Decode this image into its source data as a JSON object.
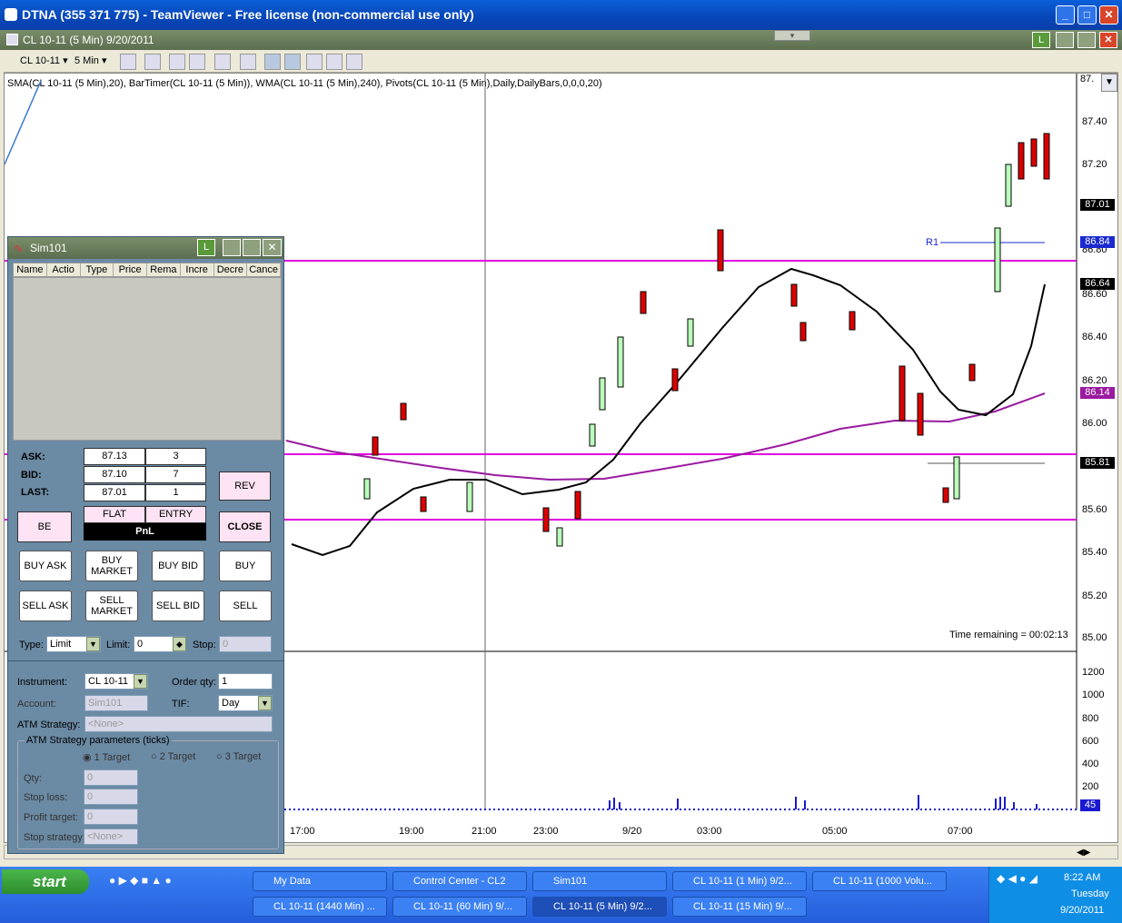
{
  "teamviewer": {
    "title": "DTNA (355 371 775) - TeamViewer - Free license (non-commercial use only)"
  },
  "chart_window": {
    "title": "CL 10-11 (5 Min)  9/20/2011"
  },
  "toolbar": {
    "instrument": "CL 10-11",
    "interval": "5 Min"
  },
  "chart": {
    "indicators": "SMA(CL 10-11 (5 Min),20), BarTimer(CL 10-11 (5 Min)), WMA(CL 10-11 (5 Min),240), Pivots(CL 10-11 (5 Min),Daily,DailyBars,0,0,0,20)",
    "y_labels": [
      "87.40",
      "87.20",
      "86.80",
      "86.60",
      "86.40",
      "86.20",
      "86.00",
      "85.60",
      "85.40",
      "85.20",
      "85.00"
    ],
    "y_top": "87.",
    "price_tags": {
      "last": "87.01",
      "r1": "86.84",
      "c1": "86.64",
      "wma": "86.14",
      "s": "85.81"
    },
    "r1_label": "R1",
    "volume_labels": [
      "1200",
      "1000",
      "800",
      "600",
      "400",
      "200"
    ],
    "volume_tag": "45",
    "time_remaining": "Time remaining = 00:02:13",
    "x_labels": [
      "17:00",
      "19:00",
      "21:00",
      "23:00",
      "9/20",
      "03:00",
      "05:00",
      "07:00"
    ]
  },
  "sim": {
    "title": "Sim101",
    "columns": [
      "Name",
      "Actio",
      "Type",
      "Price",
      "Rema",
      "Incre",
      "Decre",
      "Cance"
    ],
    "ask_label": "ASK:",
    "ask": "87.13",
    "ask_size": "3",
    "bid_label": "BID:",
    "bid": "87.10",
    "bid_size": "7",
    "last_label": "LAST:",
    "last": "87.01",
    "last_size": "1",
    "flat": "FLAT",
    "entry": "ENTRY",
    "pnl": "PnL",
    "rev": "REV",
    "be": "BE",
    "close": "CLOSE",
    "buy_ask": "BUY ASK",
    "buy_market": "BUY MARKET",
    "buy_bid": "BUY BID",
    "buy": "BUY",
    "sell_ask": "SELL ASK",
    "sell_market": "SELL MARKET",
    "sell_bid": "SELL BID",
    "sell": "SELL",
    "type_label": "Type:",
    "type_value": "Limit",
    "limit_label": "Limit:",
    "limit_value": "0",
    "stop_label": "Stop:",
    "stop_value": "0",
    "instrument_label": "Instrument:",
    "instrument_value": "CL 10-11",
    "order_qty_label": "Order qty:",
    "order_qty_value": "1",
    "account_label": "Account:",
    "account_value": "Sim101",
    "tif_label": "TIF:",
    "tif_value": "Day",
    "atm_label": "ATM Strategy:",
    "atm_value": "<None>",
    "atm_group": "ATM Strategy parameters (ticks)",
    "target1": "1 Target",
    "target2": "2 Target",
    "target3": "3 Target",
    "qty_label": "Qty:",
    "qty_value": "0",
    "stoploss_label": "Stop loss:",
    "stoploss_value": "0",
    "profit_label": "Profit target:",
    "profit_value": "0",
    "stopstrat_label": "Stop strategy:",
    "stopstrat_value": "<None>"
  },
  "taskbar": {
    "start": "start",
    "tasks_row1": [
      "My Data",
      "Control Center - CL2",
      "Sim101",
      "CL 10-11 (1 Min)  9/2...",
      "CL 10-11 (1000 Volu..."
    ],
    "tasks_row2": [
      "CL 10-11 (1440 Min)  ...",
      "CL 10-11 (60 Min)  9/...",
      "CL 10-11 (5 Min)  9/2...",
      "CL 10-11 (15 Min)  9/..."
    ],
    "time": "8:22 AM",
    "day": "Tuesday",
    "date": "9/20/2011"
  }
}
